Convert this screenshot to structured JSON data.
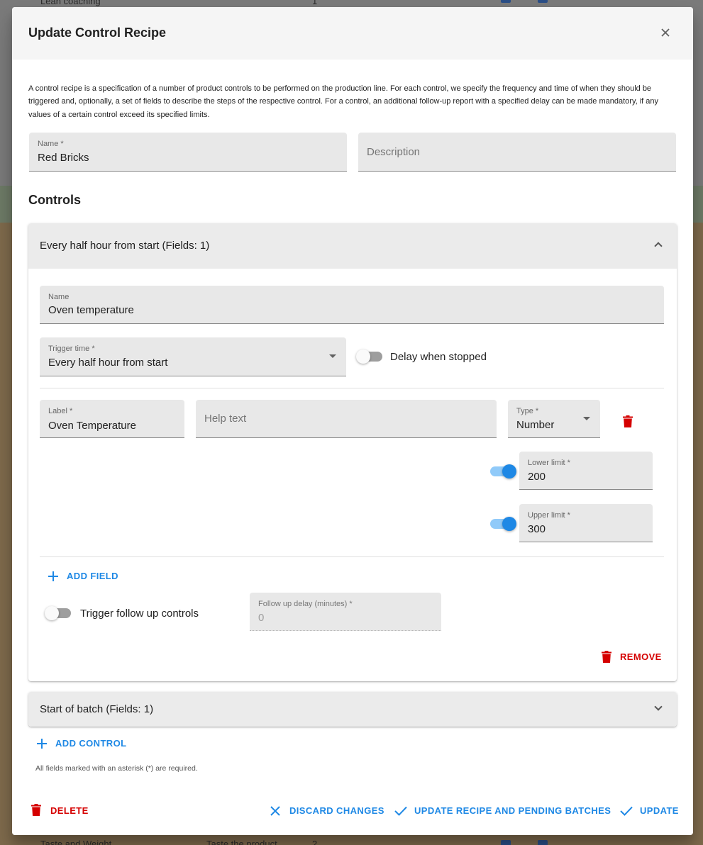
{
  "background": {
    "row_top": {
      "col1": "Lean coaching",
      "col2": "1"
    },
    "row_bottom": {
      "col1": "Taste and Weight",
      "col2": "Taste the product",
      "col3": "2"
    }
  },
  "dialog": {
    "title": "Update Control Recipe",
    "intro": "A control recipe is a specification of a number of product controls to be performed on the production line. For each control, we specify the frequency and time of when they should be triggered and, optionally, a set of fields to describe the steps of the respective control. For a control, an additional follow-up report with a specified delay can be made mandatory, if any values of a certain control exceed its specified limits.",
    "name_field": {
      "label": "Name *",
      "value": "Red Bricks"
    },
    "description_field": {
      "placeholder": "Description"
    },
    "controls_title": "Controls",
    "controls": [
      {
        "header": "Every half hour from start (Fields: 1)",
        "expanded": true,
        "name_field": {
          "label": "Name",
          "value": "Oven temperature"
        },
        "trigger_field": {
          "label": "Trigger time *",
          "value": "Every half hour from start"
        },
        "delay_when_stopped": {
          "label": "Delay when stopped",
          "on": false
        },
        "field": {
          "label_field": {
            "label": "Label *",
            "value": "Oven Temperature"
          },
          "help_field": {
            "placeholder": "Help text"
          },
          "type_field": {
            "label": "Type *",
            "value": "Number"
          },
          "lower_limit": {
            "label": "Lower limit *",
            "value": "200",
            "enabled": true
          },
          "upper_limit": {
            "label": "Upper limit *",
            "value": "300",
            "enabled": true
          }
        },
        "add_field_label": "ADD FIELD",
        "trigger_follow_up": {
          "label": "Trigger follow up controls",
          "on": false
        },
        "follow_up_delay": {
          "label": "Follow up delay (minutes) *",
          "value": "0"
        },
        "remove_label": "REMOVE"
      },
      {
        "header": "Start of batch (Fields: 1)",
        "expanded": false
      }
    ],
    "add_control_label": "ADD CONTROL",
    "required_note": "All fields marked with an asterisk (*) are required.",
    "actions": {
      "delete": "DELETE",
      "discard": "DISCARD CHANGES",
      "update_pending": "UPDATE RECIPE AND PENDING BATCHES",
      "update": "UPDATE"
    }
  },
  "colors": {
    "primary": "#1e88e5",
    "danger": "#d50000",
    "header_bg": "#f5f5f5",
    "field_bg": "#e8e8e8"
  },
  "icons": [
    "close-icon",
    "chevron-up-icon",
    "chevron-down-icon",
    "caret-down-icon",
    "trash-icon",
    "plus-icon",
    "x-icon",
    "check-icon"
  ]
}
